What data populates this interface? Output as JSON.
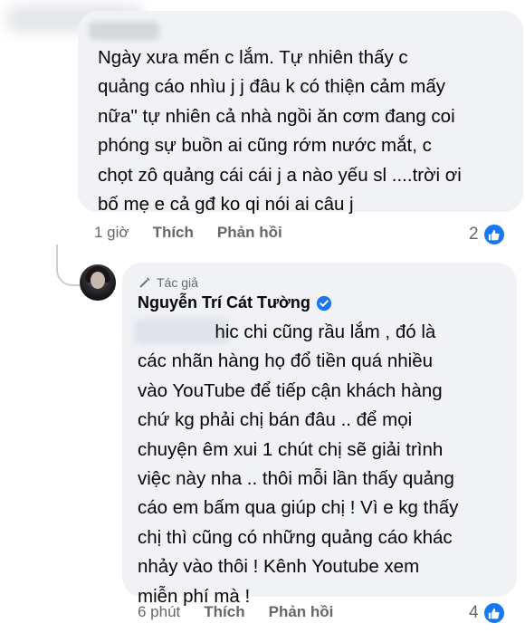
{
  "comment1": {
    "lines": [
      "Ngày xưa mến c lắm. Tự nhiên thấy c",
      "quảng cáo nhìu j j đâu k có thiện cảm mấy",
      "nữa\" tự nhiên cả nhà ngồi ăn cơm đang coi",
      "phóng sự buồn ai cũng rớm nước mắt, c",
      "chọt zô quảng cái cái j a nào yếu sl ....trời ơi",
      "bố mẹ e cả gđ ko qi nói ai câu j"
    ],
    "time": "1 giờ",
    "like_label": "Thích",
    "reply_label": "Phản hồi",
    "reaction_count": "2"
  },
  "comment2": {
    "author_tag": "Tác giả",
    "author_name": "Nguyễn Trí Cát Tường",
    "lines": [
      "               hic chi cũng rầu lắm , đó là",
      "các nhãn hàng họ đổ tiền quá nhiều",
      "vào YouTube để tiếp cận khách hàng",
      "chứ kg phải chị bán đâu .. để mọi",
      "chuyện êm xui 1 chút chị sẽ giải trình",
      "việc này nha .. thôi mỗi lần thấy quảng",
      "cáo em bấm qua giúp chị ! Vì e kg thấy",
      "chị thì cũng có những quảng cáo khác",
      "nhảy vào thôi ! Kênh Youtube xem",
      "miễn phí mà !"
    ],
    "time": "6 phút",
    "like_label": "Thích",
    "reply_label": "Phản hồi",
    "reaction_count": "4"
  },
  "colors": {
    "bubble": "#f0f2f5",
    "meta_text": "#65676b",
    "like_blue": "#1877f2",
    "verified_blue": "#1877f2"
  },
  "icons": {
    "like": "thumbs-up-icon",
    "author_badge": "pen-icon",
    "verified": "verified-badge-icon"
  }
}
